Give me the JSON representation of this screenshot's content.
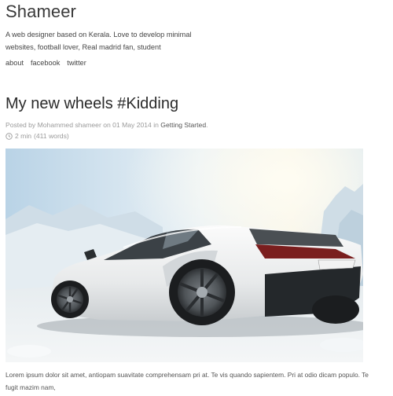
{
  "site": {
    "title": "Shameer",
    "bio": "A web designer based on Kerala. Love to develop minimal websites, football lover, Real madrid fan, student"
  },
  "nav": {
    "items": [
      {
        "label": "about"
      },
      {
        "label": "facebook"
      },
      {
        "label": "twitter"
      }
    ]
  },
  "post": {
    "title": "My new wheels #Kidding",
    "meta_prefix": "Posted by Mohammed shameer on 01 May 2014 in",
    "category": "Getting Started",
    "meta_suffix": ".",
    "reading_time": "2 min",
    "word_count": "(411 words)",
    "excerpt": "Lorem ipsum dolor sit amet, antiopam suavitate comprehensam pri at. Te vis quando sapientem. Pri at odio dicam populo. Te fugit mazim nam,"
  },
  "icons": {
    "clock": "clock-icon",
    "hero": "sports-car-image"
  }
}
